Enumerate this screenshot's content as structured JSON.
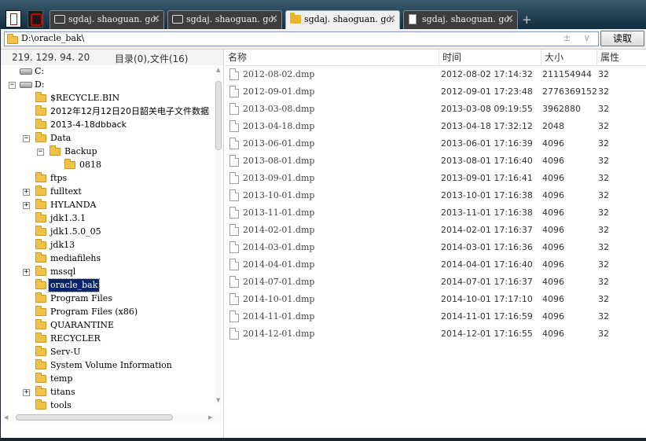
{
  "tabs": [
    {
      "label": "sgdaj. shaoguan. go.",
      "active": false,
      "icon": "window-icon"
    },
    {
      "label": "sgdaj. shaoguan. go.",
      "active": false,
      "icon": "window-icon"
    },
    {
      "label": "sgdaj. shaoguan. go.",
      "active": true,
      "icon": "folder-icon"
    },
    {
      "label": "sgdaj. shaoguan. go.",
      "active": false,
      "icon": "document-icon"
    }
  ],
  "tab_close_glyph": "✕",
  "new_tab_glyph": "+",
  "address": {
    "value": "D:\\oracle_bak\\",
    "arrows": "± ∨"
  },
  "read_button": "读取",
  "status": {
    "ip": "219. 129. 94. 20",
    "counts": "目录(0),文件(16)"
  },
  "tree": [
    {
      "label": "C:",
      "kind": "drive",
      "expander": ""
    },
    {
      "label": "D:",
      "kind": "drive",
      "expander": "−"
    },
    {
      "label": "$RECYCLE.BIN",
      "kind": "folder",
      "expander": ""
    },
    {
      "label": "2012年12月12日20日韶关电子文件数据",
      "kind": "folder",
      "expander": ""
    },
    {
      "label": "2013-4-18dbback",
      "kind": "folder",
      "expander": ""
    },
    {
      "label": "Data",
      "kind": "folder",
      "expander": "−"
    },
    {
      "label": "Backup",
      "kind": "folder",
      "expander": "−"
    },
    {
      "label": "0818",
      "kind": "folder",
      "expander": ""
    },
    {
      "label": "ftps",
      "kind": "folder",
      "expander": ""
    },
    {
      "label": "fulltext",
      "kind": "folder",
      "expander": "+"
    },
    {
      "label": "HYLANDA",
      "kind": "folder",
      "expander": "+"
    },
    {
      "label": "jdk1.3.1",
      "kind": "folder",
      "expander": ""
    },
    {
      "label": "jdk1.5.0_05",
      "kind": "folder",
      "expander": ""
    },
    {
      "label": "jdk13",
      "kind": "folder",
      "expander": ""
    },
    {
      "label": "mediafilehs",
      "kind": "folder",
      "expander": ""
    },
    {
      "label": "mssql",
      "kind": "folder",
      "expander": "+"
    },
    {
      "label": "oracle_bak",
      "kind": "folder",
      "expander": "",
      "selected": true
    },
    {
      "label": "Program Files",
      "kind": "folder",
      "expander": ""
    },
    {
      "label": "Program Files (x86)",
      "kind": "folder",
      "expander": ""
    },
    {
      "label": "QUARANTINE",
      "kind": "folder",
      "expander": ""
    },
    {
      "label": "RECYCLER",
      "kind": "folder",
      "expander": ""
    },
    {
      "label": "Serv-U",
      "kind": "folder",
      "expander": ""
    },
    {
      "label": "System Volume Information",
      "kind": "folder",
      "expander": ""
    },
    {
      "label": "temp",
      "kind": "folder",
      "expander": ""
    },
    {
      "label": "titans",
      "kind": "folder",
      "expander": "+"
    },
    {
      "label": "tools",
      "kind": "folder",
      "expander": ""
    }
  ],
  "columns": {
    "name": "名称",
    "time": "时间",
    "size": "大小",
    "attr": "属性"
  },
  "files": [
    {
      "name": "2012-08-02.dmp",
      "time": "2012-08-02 17:14:32",
      "size": "211154944",
      "attr": "32"
    },
    {
      "name": "2012-09-01.dmp",
      "time": "2012-09-01 17:23:48",
      "size": "2776369152",
      "attr": "32"
    },
    {
      "name": "2013-03-08.dmp",
      "time": "2013-03-08 09:19:55",
      "size": "3962880",
      "attr": "32"
    },
    {
      "name": "2013-04-18.dmp",
      "time": "2013-04-18 17:32:12",
      "size": "2048",
      "attr": "32"
    },
    {
      "name": "2013-06-01.dmp",
      "time": "2013-06-01 17:16:39",
      "size": "4096",
      "attr": "32"
    },
    {
      "name": "2013-08-01.dmp",
      "time": "2013-08-01 17:16:40",
      "size": "4096",
      "attr": "32"
    },
    {
      "name": "2013-09-01.dmp",
      "time": "2013-09-01 17:16:41",
      "size": "4096",
      "attr": "32"
    },
    {
      "name": "2013-10-01.dmp",
      "time": "2013-10-01 17:16:38",
      "size": "4096",
      "attr": "32"
    },
    {
      "name": "2013-11-01.dmp",
      "time": "2013-11-01 17:16:38",
      "size": "4096",
      "attr": "32"
    },
    {
      "name": "2014-02-01.dmp",
      "time": "2014-02-01 17:16:37",
      "size": "4096",
      "attr": "32"
    },
    {
      "name": "2014-03-01.dmp",
      "time": "2014-03-01 17:16:36",
      "size": "4096",
      "attr": "32"
    },
    {
      "name": "2014-04-01.dmp",
      "time": "2014-04-01 17:16:40",
      "size": "4096",
      "attr": "32"
    },
    {
      "name": "2014-07-01.dmp",
      "time": "2014-07-01 17:16:37",
      "size": "4096",
      "attr": "32"
    },
    {
      "name": "2014-10-01.dmp",
      "time": "2014-10-01 17:17:10",
      "size": "4096",
      "attr": "32"
    },
    {
      "name": "2014-11-01.dmp",
      "time": "2014-11-01 17:16:59",
      "size": "4096",
      "attr": "32"
    },
    {
      "name": "2014-12-01.dmp",
      "time": "2014-12-01 17:16:55",
      "size": "4096",
      "attr": "32"
    }
  ]
}
